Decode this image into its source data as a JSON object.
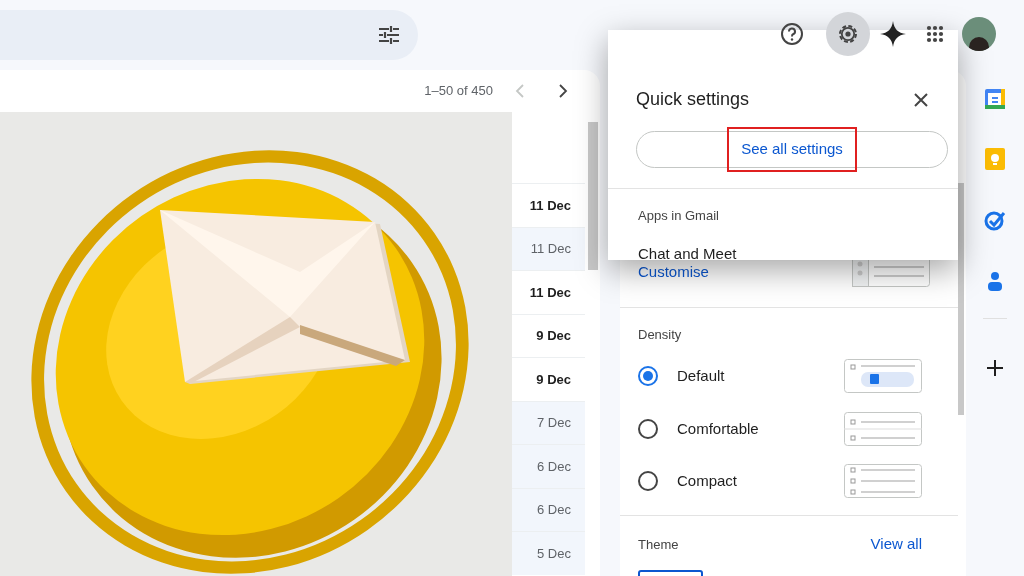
{
  "pagination": {
    "range": "1–50 of 450",
    "previous_disabled": true
  },
  "dates": [
    {
      "text": "11 Dec",
      "unread": true
    },
    {
      "text": "11 Dec",
      "unread": false
    },
    {
      "text": "11 Dec",
      "unread": true
    },
    {
      "text": "9 Dec",
      "unread": true
    },
    {
      "text": "9 Dec",
      "unread": true
    },
    {
      "text": "7 Dec",
      "unread": false
    },
    {
      "text": "6 Dec",
      "unread": false
    },
    {
      "text": "6 Dec",
      "unread": false
    },
    {
      "text": "5 Dec",
      "unread": false
    }
  ],
  "quick_settings": {
    "title": "Quick settings",
    "see_all": {
      "label": "See all settings",
      "highlighted": true
    },
    "apps": {
      "heading": "Apps in Gmail",
      "item": "Chat and Meet",
      "link": "Customise"
    },
    "density": {
      "heading": "Density",
      "options": [
        {
          "label": "Default",
          "selected": true
        },
        {
          "label": "Comfortable",
          "selected": false
        },
        {
          "label": "Compact",
          "selected": false
        }
      ]
    },
    "theme": {
      "heading": "Theme",
      "link": "View all"
    }
  }
}
